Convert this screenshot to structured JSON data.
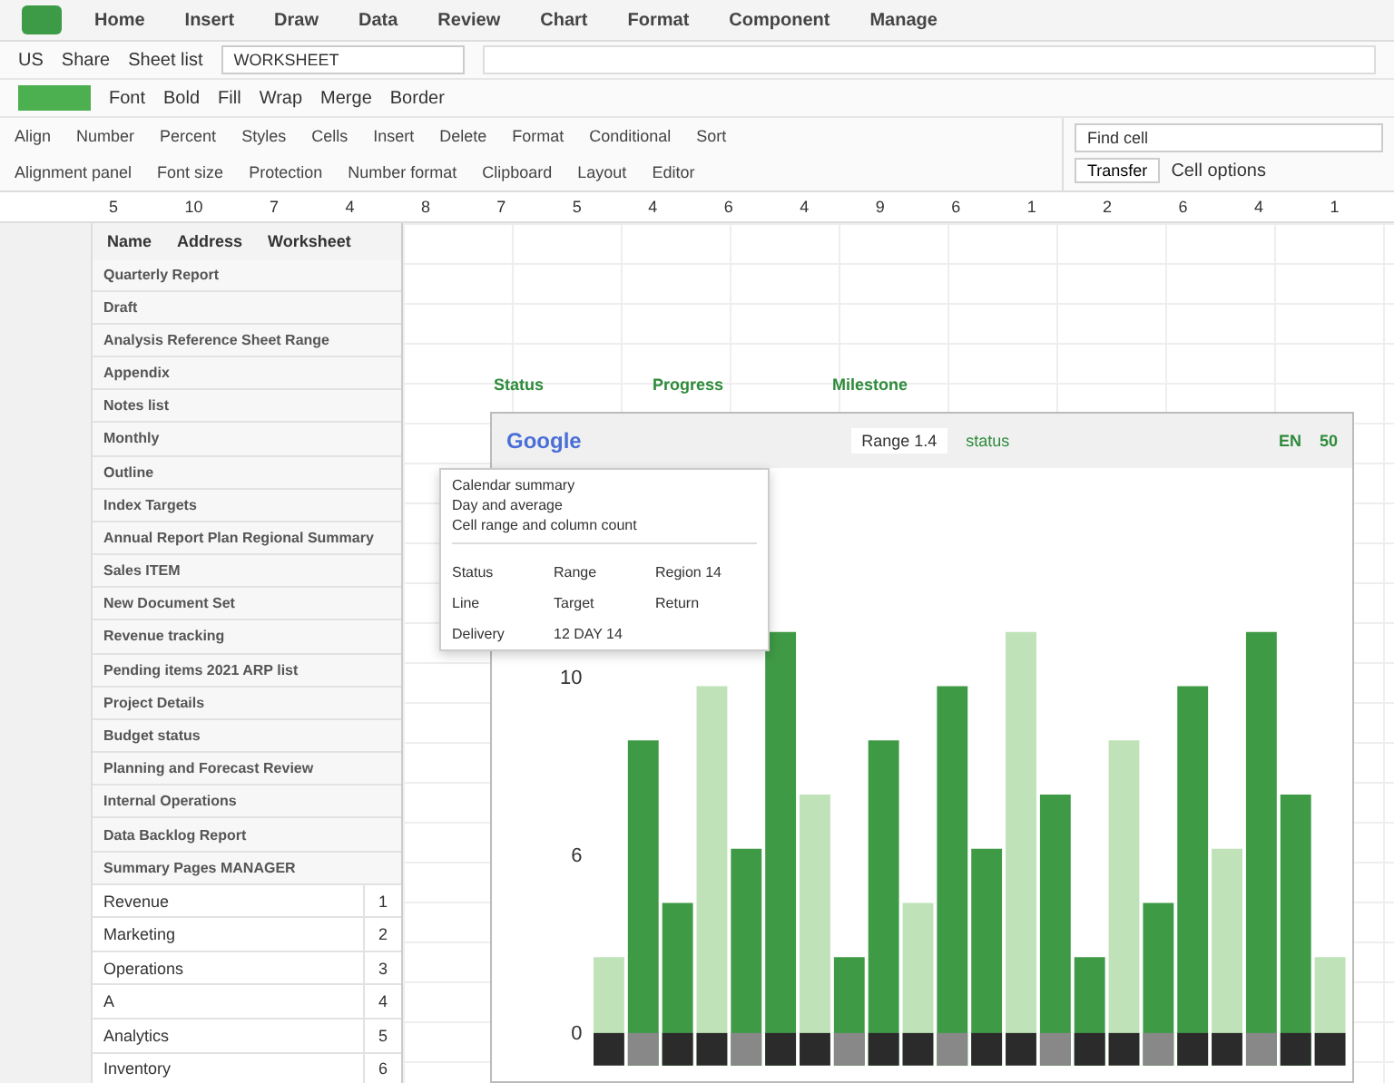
{
  "menu": [
    "Home",
    "Insert",
    "Draw",
    "Data",
    "Review",
    "Chart",
    "Format",
    "Component",
    "Manage"
  ],
  "quick_bar": {
    "items": [
      "US",
      "Share",
      "Sheet list"
    ],
    "name_box": "WORKSHEET"
  },
  "ribbon_top": [
    "Font",
    "Bold",
    "Fill",
    "Wrap",
    "Merge",
    "Border"
  ],
  "ribbon_row": [
    "Align",
    "Number",
    "Percent",
    "Styles",
    "Cells",
    "Insert",
    "Delete",
    "Format",
    "Conditional",
    "Sort"
  ],
  "ribbon_labels": [
    "Alignment panel",
    "Font size",
    "Protection",
    "Number format",
    "Clipboard",
    "Layout",
    "Editor"
  ],
  "ribbon_right": {
    "field": "Find cell",
    "button": "Transfer",
    "note": "Cell options"
  },
  "ruler": [
    "5",
    "10",
    "7",
    "4",
    "8",
    "7",
    "5",
    "4",
    "6",
    "4",
    "9",
    "6",
    "1",
    "2",
    "6",
    "4",
    "1"
  ],
  "panel": {
    "header": [
      "Name",
      "Address",
      "Worksheet"
    ],
    "items": [
      {
        "label": "Quarterly Report"
      },
      {
        "label": "Draft"
      },
      {
        "label": "Analysis Reference Sheet Range"
      },
      {
        "label": "Appendix"
      },
      {
        "label": "Notes list"
      },
      {
        "label": "Monthly"
      },
      {
        "label": "Outline"
      },
      {
        "label": "Index Targets"
      },
      {
        "label": "Annual Report Plan Regional Summary"
      },
      {
        "label": "Sales ITEM"
      },
      {
        "label": "New Document Set"
      },
      {
        "label": "Revenue tracking"
      },
      {
        "label": "Pending items 2021 ARP list"
      },
      {
        "label": "Project Details"
      },
      {
        "label": "Budget status"
      },
      {
        "label": "Planning and Forecast Review"
      },
      {
        "label": "Internal Operations"
      },
      {
        "label": "Data Backlog Report"
      },
      {
        "label": "Summary Pages MANAGER"
      }
    ],
    "table": [
      [
        "Revenue",
        "1"
      ],
      [
        "Marketing",
        "2"
      ],
      [
        "Operations",
        "3"
      ],
      [
        "A",
        "4"
      ],
      [
        "Analytics",
        "5"
      ],
      [
        "Inventory",
        "6"
      ]
    ]
  },
  "sheet_header": [
    "Status",
    "Progress",
    "Milestone"
  ],
  "chart": {
    "title": "Google",
    "range": "Range 1.4",
    "tag": "status",
    "badges": [
      "EN",
      "50"
    ],
    "y_ticks": [
      "10",
      "6",
      "0"
    ],
    "popover": {
      "lines": [
        "Calendar summary",
        "Day and average",
        "Cell range and column count"
      ],
      "rows": [
        [
          "Status",
          "Range",
          "Region 14"
        ],
        [
          "Line",
          "Target",
          "Return"
        ],
        [
          "Delivery",
          "12 DAY 14",
          ""
        ]
      ]
    }
  }
}
